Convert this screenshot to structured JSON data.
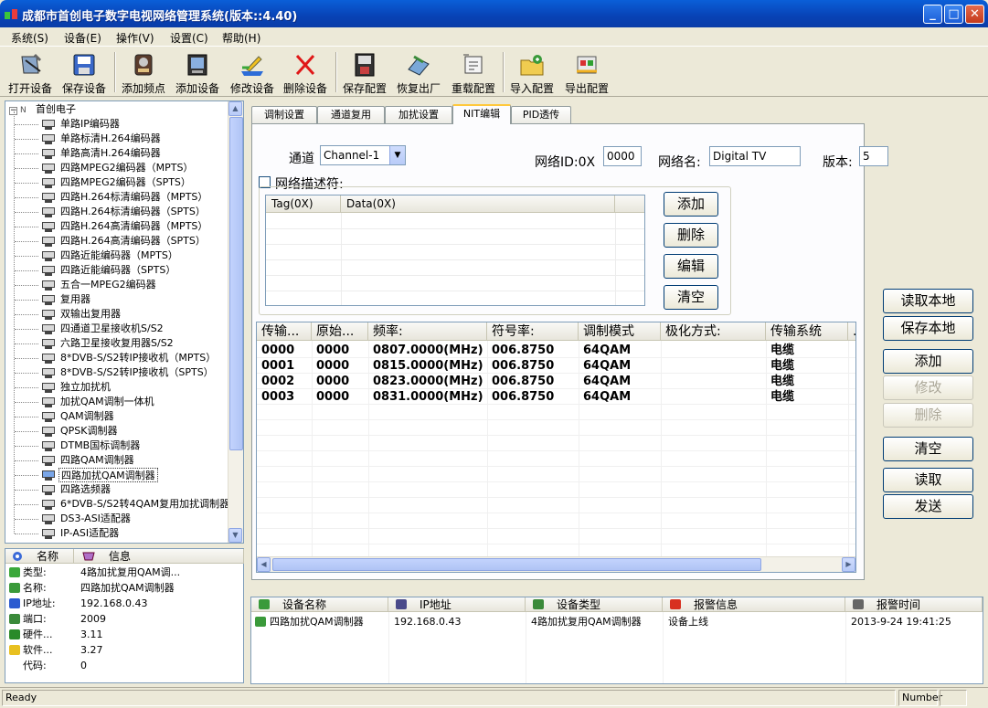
{
  "window": {
    "title": "成都市首创电子数字电视网络管理系统(版本::4.40)",
    "minimize_glyph": "_",
    "maximize_glyph": "□",
    "close_glyph": "✕"
  },
  "menu": [
    "系统(S)",
    "设备(E)",
    "操作(V)",
    "设置(C)",
    "帮助(H)"
  ],
  "toolbar": [
    {
      "label": "打开设备",
      "icon": "open-device-icon"
    },
    {
      "label": "保存设备",
      "icon": "save-device-icon"
    },
    {
      "label": "添加频点",
      "icon": "add-frequency-icon"
    },
    {
      "label": "添加设备",
      "icon": "add-device-icon"
    },
    {
      "label": "修改设备",
      "icon": "edit-device-icon"
    },
    {
      "label": "删除设备",
      "icon": "delete-device-icon"
    },
    {
      "label": "保存配置",
      "icon": "save-config-icon"
    },
    {
      "label": "恢复出厂",
      "icon": "factory-reset-icon"
    },
    {
      "label": "重载配置",
      "icon": "reload-config-icon"
    },
    {
      "label": "导入配置",
      "icon": "import-config-icon"
    },
    {
      "label": "导出配置",
      "icon": "export-config-icon"
    }
  ],
  "tree": {
    "root": "首创电子",
    "root_expand": "−",
    "items": [
      "单路IP编码器",
      "单路标清H.264编码器",
      "单路高清H.264编码器",
      "四路MPEG2编码器（MPTS）",
      "四路MPEG2编码器（SPTS）",
      "四路H.264标清编码器（MPTS）",
      "四路H.264标清编码器（SPTS）",
      "四路H.264高清编码器（MPTS）",
      "四路H.264高清编码器（SPTS）",
      "四路近能编码器（MPTS）",
      "四路近能编码器（SPTS）",
      "五合一MPEG2编码器",
      "复用器",
      "双输出复用器",
      "四通道卫星接收机S/S2",
      "六路卫星接收复用器S/S2",
      "8*DVB-S/S2转IP接收机（MPTS）",
      "8*DVB-S/S2转IP接收机（SPTS）",
      "独立加扰机",
      "加扰QAM调制一体机",
      "QAM调制器",
      "QPSK调制器",
      "DTMB国标调制器",
      "四路QAM调制器",
      "四路加扰QAM调制器",
      "四路选频器",
      "6*DVB-S/S2转4QAM复用加扰调制器",
      "DS3-ASI适配器",
      "IP-ASI适配器"
    ],
    "selected_index": 24
  },
  "info": {
    "headers": {
      "name": "名称",
      "value": "信息"
    },
    "rows": [
      {
        "label": "类型:",
        "value": "4路加扰复用QAM调...",
        "icon": "type-icon"
      },
      {
        "label": "名称:",
        "value": "四路加扰QAM调制器",
        "icon": "name-icon"
      },
      {
        "label": "IP地址:",
        "value": "192.168.0.43",
        "icon": "ip-icon"
      },
      {
        "label": "端口:",
        "value": "2009",
        "icon": "port-icon"
      },
      {
        "label": "硬件...",
        "value": "3.11",
        "icon": "hardware-icon"
      },
      {
        "label": "软件...",
        "value": "3.27",
        "icon": "software-icon"
      },
      {
        "label": "代码:",
        "value": "0",
        "icon": ""
      }
    ]
  },
  "tabs": [
    "调制设置",
    "通道复用",
    "加扰设置",
    "NIT编辑",
    "PID透传"
  ],
  "active_tab": 3,
  "nit": {
    "channel_label": "通道",
    "channel_value": "Channel-1",
    "network_id_label": "网络ID:0X",
    "network_id_value": "0000",
    "network_name_label": "网络名:",
    "network_name_value": "Digital TV",
    "version_label": "版本:",
    "version_value": "5",
    "descriptor_label": "网络描述符:",
    "descriptor_headers": [
      "Tag(0X)",
      "Data(0X)"
    ],
    "descriptor_buttons": [
      "添加",
      "删除",
      "编辑",
      "清空"
    ],
    "stream_headers": [
      "传输...",
      "原始...",
      "频率:",
      "符号率:",
      "调制模式",
      "极化方式:",
      "传输系统",
      "..."
    ],
    "streams": [
      [
        "0000",
        "0000",
        "0807.0000(MHz)",
        "006.8750",
        "64QAM",
        "",
        "电缆"
      ],
      [
        "0001",
        "0000",
        "0815.0000(MHz)",
        "006.8750",
        "64QAM",
        "",
        "电缆"
      ],
      [
        "0002",
        "0000",
        "0823.0000(MHz)",
        "006.8750",
        "64QAM",
        "",
        "电缆"
      ],
      [
        "0003",
        "0000",
        "0831.0000(MHz)",
        "006.8750",
        "64QAM",
        "",
        "电缆"
      ]
    ]
  },
  "right_buttons": [
    {
      "label": "读取本地",
      "enabled": true
    },
    {
      "label": "保存本地",
      "enabled": true
    },
    {
      "label": "添加",
      "enabled": true
    },
    {
      "label": "修改",
      "enabled": false
    },
    {
      "label": "删除",
      "enabled": false
    },
    {
      "label": "清空",
      "enabled": true
    },
    {
      "label": "读取",
      "enabled": true
    },
    {
      "label": "发送",
      "enabled": true
    }
  ],
  "alarm": {
    "headers": [
      "设备名称",
      "IP地址",
      "设备类型",
      "报警信息",
      "报警时间"
    ],
    "rows": [
      [
        "四路加扰QAM调制器",
        "192.168.0.43",
        "4路加扰复用QAM调制器",
        "设备上线",
        "2013-9-24 19:41:25"
      ]
    ]
  },
  "status": {
    "text": "Ready",
    "number_label": "Number"
  },
  "colors": {
    "title_bar": "#0842b5",
    "highlight": "#316ac5",
    "panel": "#ece9d8"
  }
}
